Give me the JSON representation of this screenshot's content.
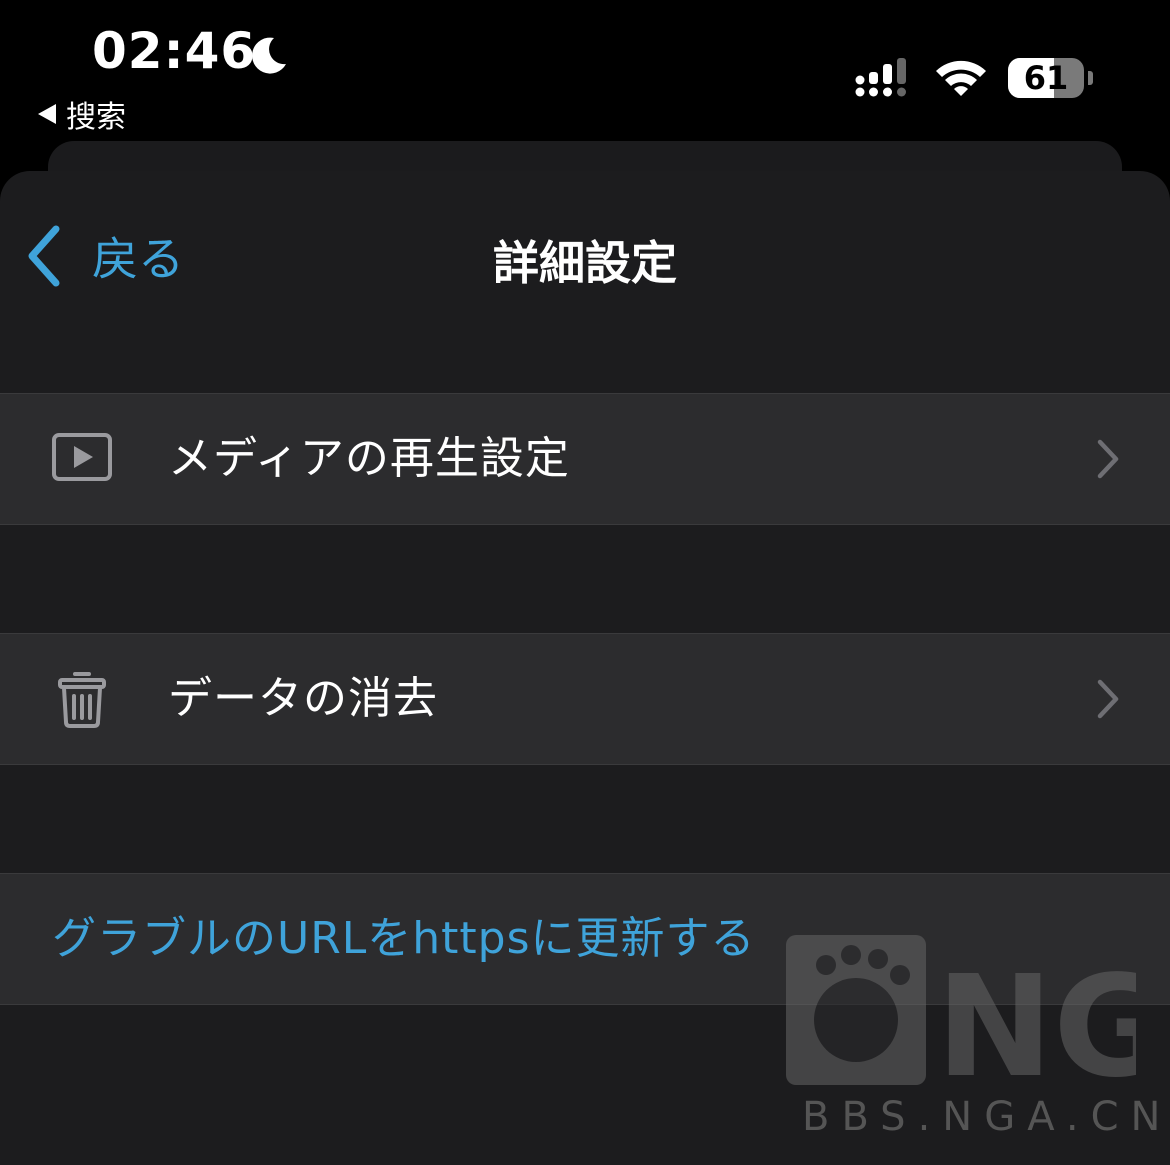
{
  "status_bar": {
    "time": "02:46",
    "back_app_label": "搜索",
    "battery_level": "61",
    "battery_fraction": 0.61,
    "icons": [
      "moon-icon",
      "cellular-signal-icon",
      "wifi-icon",
      "battery-icon"
    ]
  },
  "nav": {
    "back_label": "戻る",
    "title": "詳細設定"
  },
  "rows": {
    "media": {
      "label": "メディアの再生設定",
      "icon": "play-rectangle-icon"
    },
    "clear_data": {
      "label": "データの消去",
      "icon": "trash-icon"
    },
    "https": {
      "label": "グラブルのURLをhttpsに更新する"
    }
  },
  "colors": {
    "accent": "#3fa3da",
    "background": "#000000",
    "sheet": "#1c1c1e",
    "cell": "#2c2c2e"
  },
  "watermark": {
    "logo_text": "NGA",
    "url": "BBS.NGA.CN"
  }
}
